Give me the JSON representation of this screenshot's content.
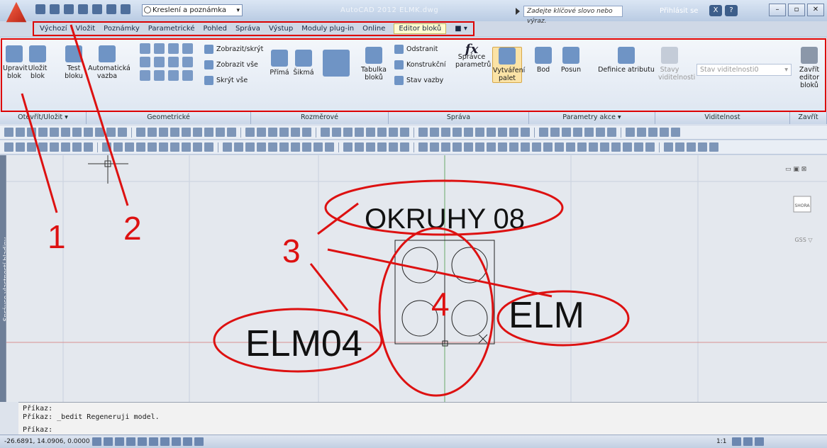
{
  "titlebar": {
    "workspace": "Kreslení a poznámka",
    "app_title": "AutoCAD 2012   ELMK.dwg",
    "search_placeholder": "Zadejte klíčové slovo nebo výraz.",
    "login": "Přihlásit se"
  },
  "tabs": [
    "Výchozí",
    "Vložit",
    "Poznámky",
    "Parametrické",
    "Pohled",
    "Správa",
    "Výstup",
    "Moduly plug-in",
    "Online",
    "Editor bloků"
  ],
  "active_tab": "Editor bloků",
  "ribbon": {
    "open_save": {
      "edit_block": "Upravit blok",
      "save_block": "Uložit blok",
      "test_block": "Test bloku",
      "panel": "Otevřít/Uložit ▾"
    },
    "geometric": {
      "auto_constraint": "Automatická vazba",
      "show_hide": "Zobrazit/skrýt",
      "show_all": "Zobrazit vše",
      "hide_all": "Skrýt vše",
      "panel": "Geometrické"
    },
    "dimensional": {
      "linear": "Přímá",
      "aligned": "Šikmá",
      "table": "Tabulka bloků",
      "panel": "Rozměrové"
    },
    "manage": {
      "delete": "Odstranit",
      "construction": "Konstrukční",
      "constraint_status": "Stav vazby",
      "param_manager": "Správce parametrů",
      "authoring_palettes": "Vytváření palet",
      "panel": "Správa"
    },
    "action_params": {
      "point": "Bod",
      "move": "Posun",
      "attdef": "Definice atributu",
      "panel": "Parametry akce ▾"
    },
    "visibility": {
      "states": "Stavy viditelnosti",
      "state_combo": "Stav viditelnosti0",
      "panel": "Viditelnost"
    },
    "close": {
      "close_editor": "Zavřít editor bloků",
      "panel": "Zavřít"
    }
  },
  "drawing": {
    "mirrored_text": "OKRUHY 08",
    "text_elm04": "ELM04",
    "text_elm": "ELM",
    "viewcube_top": "SHORA",
    "wcs": "GSS ▽"
  },
  "annotations": [
    "1",
    "2",
    "3",
    "4"
  ],
  "side_panel": "Správce vlastností hladiny",
  "command": {
    "line1": "Příkaz:",
    "line2": "Příkaz: _bedit Regeneruji model.",
    "line3": "Příkaz:"
  },
  "status": {
    "coords": "-26.6891, 14.0906, 0.0000",
    "scale": "1:1"
  },
  "colors": {
    "annotation_red": "#dd1111",
    "tab_active": "#fffbd0"
  }
}
